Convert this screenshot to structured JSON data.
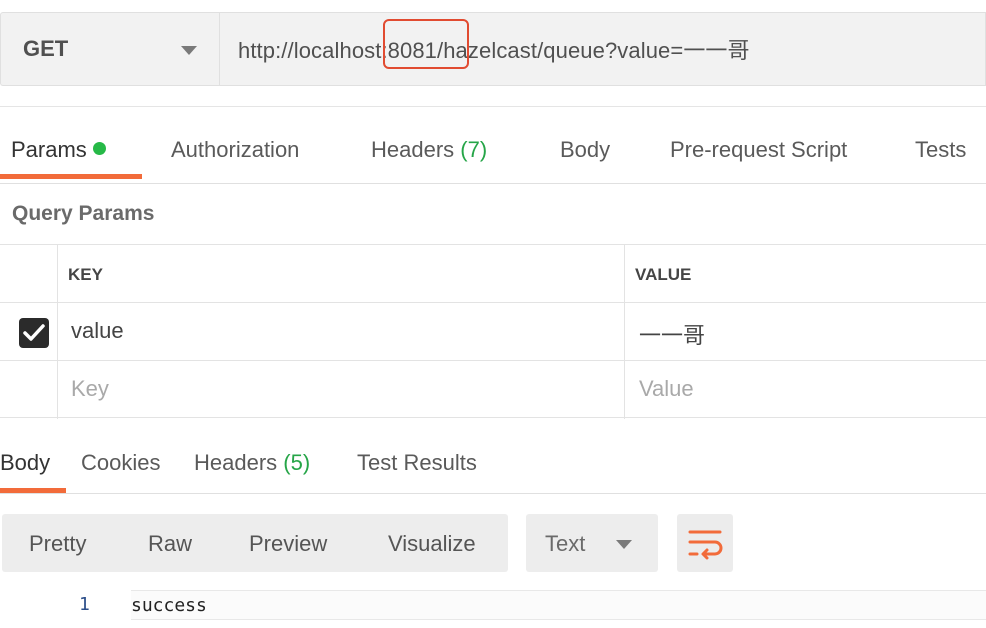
{
  "request": {
    "method": "GET",
    "url": "http://localhost:8081/hazelcast/queue?value=一一哥"
  },
  "request_tabs": [
    {
      "label": "Params",
      "active": true
    },
    {
      "label": "Authorization"
    },
    {
      "label": "Headers",
      "count": "(7)"
    },
    {
      "label": "Body"
    },
    {
      "label": "Pre-request Script"
    },
    {
      "label": "Tests"
    }
  ],
  "query_params": {
    "title": "Query Params",
    "columns": [
      "KEY",
      "VALUE"
    ],
    "rows": [
      {
        "checked": true,
        "key": "value",
        "value": "一一哥"
      }
    ],
    "placeholder_key": "Key",
    "placeholder_value": "Value"
  },
  "response_tabs": [
    {
      "label": "Body",
      "active": true
    },
    {
      "label": "Cookies"
    },
    {
      "label": "Headers",
      "count": "(5)"
    },
    {
      "label": "Test Results"
    }
  ],
  "view_modes": [
    "Pretty",
    "Raw",
    "Preview",
    "Visualize"
  ],
  "format": "Text",
  "response_body": {
    "line_number": "1",
    "text": "success"
  },
  "colors": {
    "accent": "#f26b3a",
    "count_green": "#26a548",
    "highlight_red": "#e14b31"
  }
}
